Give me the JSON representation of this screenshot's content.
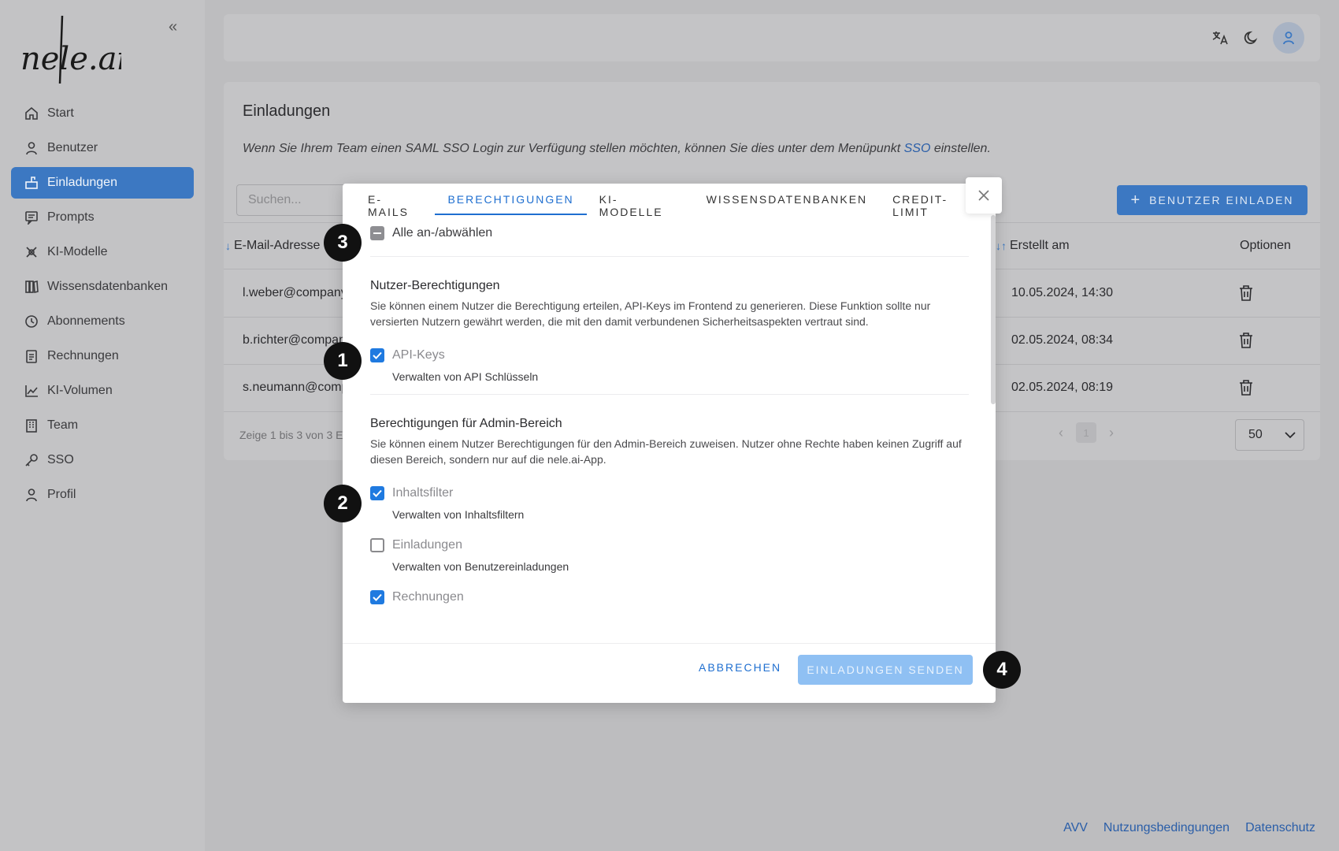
{
  "app": {
    "logo_text": "nele.ai",
    "collapse_icon": "double-chevron-left-icon"
  },
  "sidebar": {
    "items": [
      {
        "label": "Start",
        "icon": "home-icon",
        "active": false
      },
      {
        "label": "Benutzer",
        "icon": "user-icon",
        "active": false
      },
      {
        "label": "Einladungen",
        "icon": "mailbox-icon",
        "active": true
      },
      {
        "label": "Prompts",
        "icon": "prompt-icon",
        "active": false
      },
      {
        "label": "KI-Modelle",
        "icon": "model-icon",
        "active": false
      },
      {
        "label": "Wissensdatenbanken",
        "icon": "books-icon",
        "active": false
      },
      {
        "label": "Abonnements",
        "icon": "clock-icon",
        "active": false
      },
      {
        "label": "Rechnungen",
        "icon": "invoice-icon",
        "active": false
      },
      {
        "label": "KI-Volumen",
        "icon": "chart-icon",
        "active": false
      },
      {
        "label": "Team",
        "icon": "building-icon",
        "active": false
      },
      {
        "label": "SSO",
        "icon": "key-icon",
        "active": false
      },
      {
        "label": "Profil",
        "icon": "user-icon",
        "active": false
      }
    ]
  },
  "topbar": {
    "icons": [
      "translate-icon",
      "moon-icon",
      "avatar-icon"
    ]
  },
  "page": {
    "title": "Einladungen",
    "info_before": "Wenn Sie Ihrem Team einen SAML SSO Login zur Verfügung stellen möchten, können Sie dies unter dem Menüpunkt ",
    "info_link": "SSO",
    "info_after": " einstellen.",
    "search_placeholder": "Suchen...",
    "invite_button": "BENUTZER EINLADEN"
  },
  "table": {
    "headers": {
      "email": "E-Mail-Adresse",
      "created": "Erstellt am",
      "options": "Optionen"
    },
    "rows": [
      {
        "email": "l.weber@company.com",
        "created": "10.05.2024, 14:30"
      },
      {
        "email": "b.richter@company.com",
        "created": "02.05.2024, 08:34"
      },
      {
        "email": "s.neumann@company.com",
        "created": "02.05.2024, 08:19"
      }
    ],
    "pagination_text": "Zeige 1 bis 3 von 3 Einträgen",
    "current_page": "1",
    "per_page": "50"
  },
  "footer": {
    "links": [
      "AVV",
      "Nutzungsbedingungen",
      "Datenschutz"
    ]
  },
  "modal": {
    "tabs": [
      {
        "label": "E-MAILS",
        "active": false
      },
      {
        "label": "BERECHTIGUNGEN",
        "active": true
      },
      {
        "label": "KI-MODELLE",
        "active": false
      },
      {
        "label": "WISSENSDATENBANKEN",
        "active": false
      },
      {
        "label": "CREDIT-LIMIT",
        "active": false
      }
    ],
    "select_all": "Alle an-/abwählen",
    "user_section": {
      "title": "Nutzer-Berechtigungen",
      "description": "Sie können einem Nutzer die Berechtigung erteilen, API-Keys im Frontend zu generieren. Diese Funktion sollte nur versierten Nutzern gewährt werden, die mit den damit verbundenen Sicherheitsaspekten vertraut sind.",
      "items": [
        {
          "label": "API-Keys",
          "sub": "Verwalten von API Schlüsseln",
          "checked": true
        }
      ]
    },
    "admin_section": {
      "title": "Berechtigungen für Admin-Bereich",
      "description": "Sie können einem Nutzer Berechtigungen für den Admin-Bereich zuweisen. Nutzer ohne Rechte haben keinen Zugriff auf diesen Bereich, sondern nur auf die nele.ai-App.",
      "items": [
        {
          "label": "Inhaltsfilter",
          "sub": "Verwalten von Inhaltsfiltern",
          "checked": true
        },
        {
          "label": "Einladungen",
          "sub": "Verwalten von Benutzereinladungen",
          "checked": false
        },
        {
          "label": "Rechnungen",
          "sub": "",
          "checked": true
        }
      ]
    },
    "cancel_button": "ABBRECHEN",
    "send_button": "EINLADUNGEN SENDEN"
  },
  "badges": [
    "1",
    "2",
    "3",
    "4"
  ],
  "colors": {
    "accent": "#1f7ae0",
    "sidebar_active": "#3c78c2",
    "send_disabled": "#8fc0f3",
    "badge": "#111111"
  }
}
